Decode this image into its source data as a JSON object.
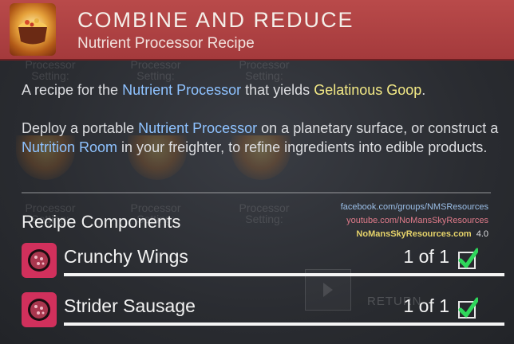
{
  "header": {
    "title": "COMBINE AND REDUCE",
    "subtitle": "Nutrient Processor Recipe",
    "icon": "cooking-pot-icon",
    "color": "#b0403f"
  },
  "description": {
    "p1_prefix": "A recipe for the ",
    "p1_link1": "Nutrient Processor",
    "p1_mid": " that yields ",
    "p1_link2": "Gelatinous Goop",
    "p1_suffix": ".",
    "p2_prefix": "Deploy a portable ",
    "p2_link1": "Nutrient Processor",
    "p2_mid": " on a planetary surface, or construct a ",
    "p2_link2": "Nutrition Room",
    "p2_suffix": " in your freighter, to refine ingredients into edible products."
  },
  "watermark": {
    "facebook": "facebook.com/groups/NMSResources",
    "youtube": "youtube.com/NoMansSkyResources",
    "site": "NoMansSkyResources.com",
    "version": "4.0"
  },
  "components": {
    "title": "Recipe Components",
    "items": [
      {
        "name": "Crunchy Wings",
        "count": "1 of 1",
        "icon": "ingredient-icon"
      },
      {
        "name": "Strider Sausage",
        "count": "1 of 1",
        "icon": "ingredient-icon"
      }
    ]
  },
  "background": {
    "ghost_label": "Processor Setting:",
    "return_label": "RETURN"
  }
}
